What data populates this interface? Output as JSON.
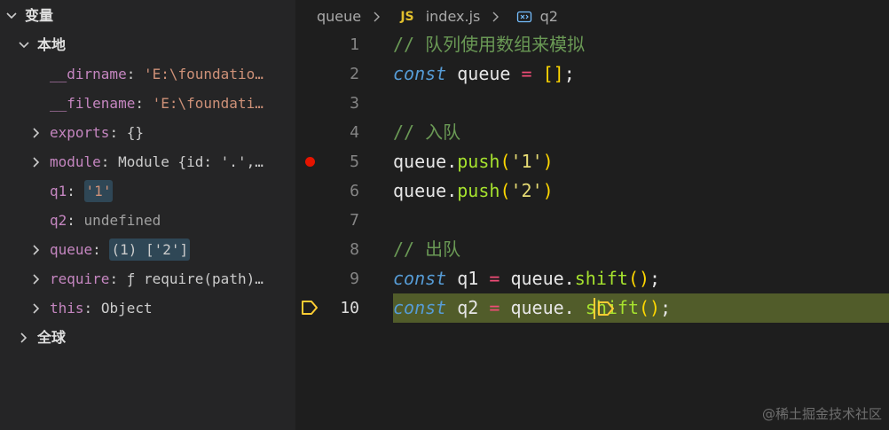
{
  "variables_panel": {
    "title": "变量",
    "local_section": "本地",
    "global_section": "全球",
    "items": [
      {
        "name": "__dirname",
        "value": "'E:\\foundatio…"
      },
      {
        "name": "__filename",
        "value": "'E:\\foundati…"
      },
      {
        "name": "exports",
        "value": "{}"
      },
      {
        "name": "module",
        "value": "Module {id: '.',…"
      },
      {
        "name": "q1",
        "value": "'1'"
      },
      {
        "name": "q2",
        "value": "undefined"
      },
      {
        "name": "queue",
        "value": "(1) ['2']"
      },
      {
        "name": "require",
        "value": "ƒ require(path)…"
      },
      {
        "name": "this",
        "value": "Object"
      }
    ],
    "colon": ":"
  },
  "breadcrumb": {
    "folder": "queue",
    "file_badge": "JS",
    "file": "index.js",
    "symbol": "q2"
  },
  "editor": {
    "current_line": 10,
    "breakpoint_line": 5,
    "lines": [
      {
        "num": "1",
        "tokens": [
          "// 队列使用数组来模拟"
        ]
      },
      {
        "num": "2",
        "tokens": [
          "const",
          " queue ",
          "=",
          " ",
          "[]",
          ";"
        ]
      },
      {
        "num": "3",
        "tokens": []
      },
      {
        "num": "4",
        "tokens": [
          "// 入队"
        ]
      },
      {
        "num": "5",
        "tokens": [
          "queue",
          ".",
          "push",
          "(",
          "'1'",
          ")"
        ]
      },
      {
        "num": "6",
        "tokens": [
          "queue",
          ".",
          "push",
          "(",
          "'2'",
          ")"
        ]
      },
      {
        "num": "7",
        "tokens": []
      },
      {
        "num": "8",
        "tokens": [
          "// 出队"
        ]
      },
      {
        "num": "9",
        "tokens": [
          "const",
          " q1 ",
          "=",
          " queue.",
          "shift",
          "()",
          ";"
        ]
      },
      {
        "num": "10",
        "tokens": [
          "const",
          " q2 ",
          "=",
          " queue.",
          " ",
          "shift",
          "()",
          ";"
        ]
      }
    ]
  },
  "watermark": "@稀土掘金技术社区",
  "colors": {
    "accent_yellow": "#ffcc33",
    "breakpoint_red": "#e51400",
    "current_line_bg": "#515c2a"
  }
}
